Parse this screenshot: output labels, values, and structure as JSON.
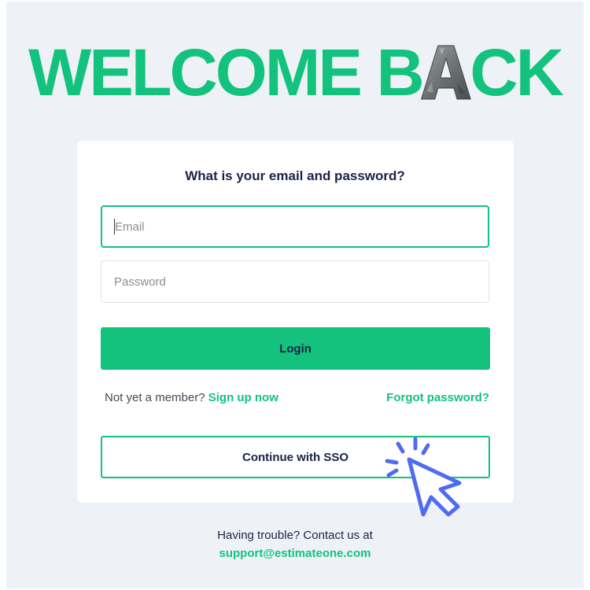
{
  "hero": {
    "title_part1": "WELCOME B",
    "stone_letter": "A",
    "title_part2": "CK"
  },
  "login_card": {
    "title": "What is your email and password?",
    "email": {
      "placeholder": "Email",
      "value": ""
    },
    "password": {
      "placeholder": "Password",
      "value": ""
    },
    "login_button_label": "Login",
    "signup_prompt": "Not yet a member?",
    "signup_link_label": "Sign up now",
    "forgot_password_label": "Forgot password?",
    "sso_button_label": "Continue with SSO"
  },
  "footer": {
    "help_text": "Having trouble? Contact us at",
    "support_email": "support@estimateone.com"
  },
  "icons": {
    "cursor": "click-cursor-icon",
    "stone_letter": "stone-letter-icon"
  },
  "colors": {
    "accent": "#12c27d",
    "page_background": "#eef2f6",
    "card_background": "#ffffff",
    "heading_text": "#1b2345",
    "cursor_blue": "#4f6bef"
  }
}
